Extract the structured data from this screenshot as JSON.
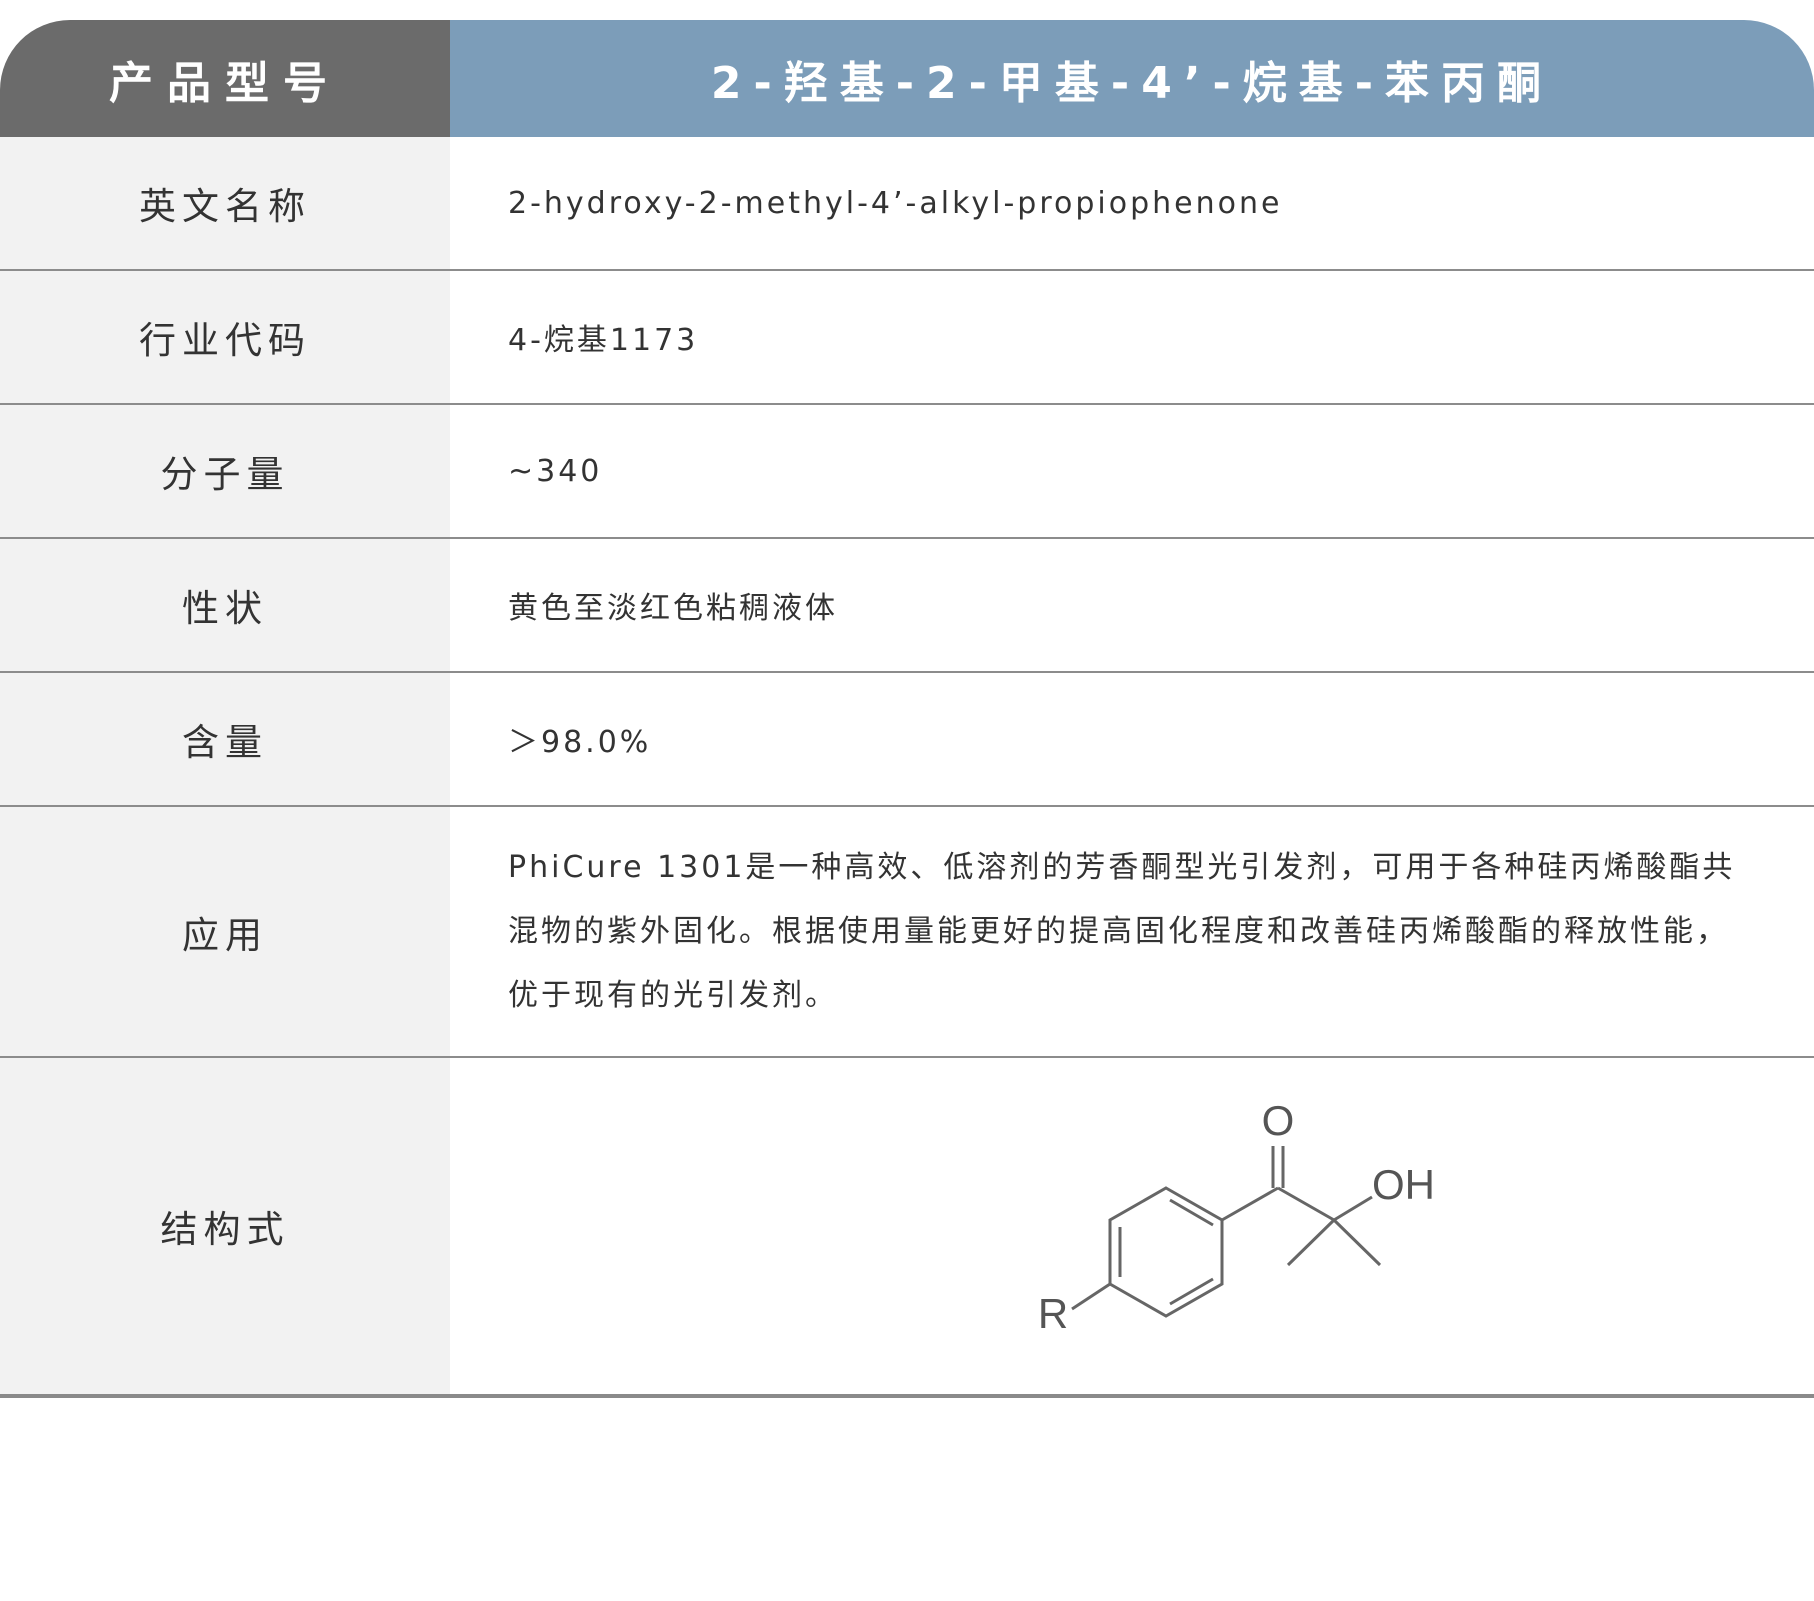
{
  "header": {
    "label": "产品型号",
    "value": "2-羟基-2-甲基-4’-烷基-苯丙酮"
  },
  "rows": [
    {
      "label": "英文名称",
      "value": "2-hydroxy-2-methyl-4’-alkyl-propiophenone"
    },
    {
      "label": "行业代码",
      "value": "4-烷基1173"
    },
    {
      "label": "分子量",
      "value": "~340"
    },
    {
      "label": "性状",
      "value": "黄色至淡红色粘稠液体"
    },
    {
      "label": "含量",
      "value": "＞98.0%"
    },
    {
      "label": "应用",
      "value": "PhiCure 1301是一种高效、低溶剂的芳香酮型光引发剂，可用于各种硅丙烯酸酯共混物的紫外固化。根据使用量能更好的提高固化程度和改善硅丙烯酸酯的释放性能，优于现有的光引发剂。"
    },
    {
      "label": "结构式",
      "value": ""
    }
  ],
  "structure": {
    "atom_o": "O",
    "atom_oh": "OH",
    "atom_r": "R"
  },
  "colors": {
    "header_left": "#6b6b6b",
    "header_right": "#7c9db9",
    "label_bg": "#f2f2f2",
    "divider": "#8c8c8c"
  }
}
